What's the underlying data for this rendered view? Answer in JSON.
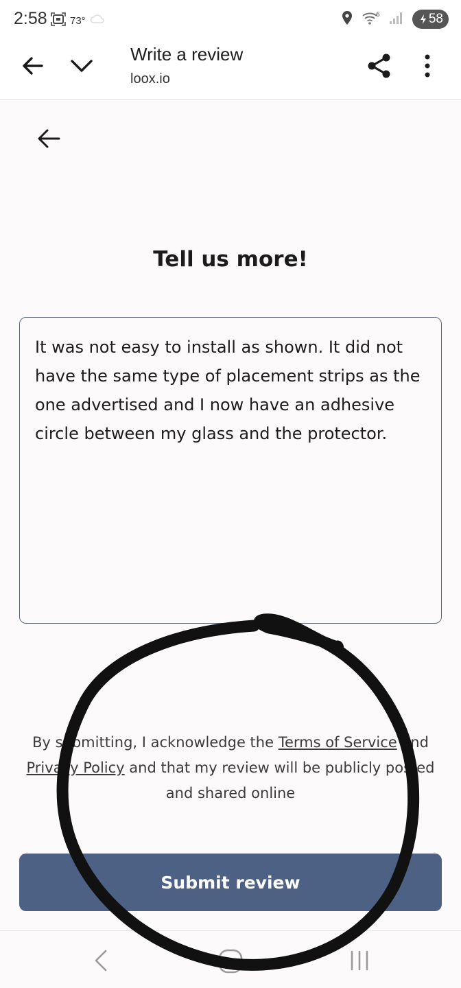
{
  "status_bar": {
    "time": "2:58",
    "temperature": "73°",
    "battery": "58",
    "icons": [
      "screenshot-icon",
      "weather-icon",
      "location-icon",
      "wifi-icon",
      "signal-icon",
      "battery-icon"
    ]
  },
  "browser": {
    "title": "Write a review",
    "url": "loox.io",
    "icons": [
      "back-arrow-icon",
      "chevron-down-icon",
      "share-icon",
      "more-vert-icon"
    ]
  },
  "page": {
    "heading": "Tell us more!",
    "review_text": "It was not easy to install as shown. It did not have the same type of placement strips as the one advertised and I now have an adhesive circle between my glass and the protector.",
    "consent": {
      "prefix": "By submitting, I acknowledge the ",
      "terms_link": "Terms of Service",
      "middle": " and ",
      "privacy_link": "Privacy Policy",
      "suffix": " and that my review will be publicly posted and shared online"
    },
    "submit_label": "Submit review"
  },
  "nav": {
    "icons": [
      "nav-back-icon",
      "nav-home-icon",
      "nav-recents-icon"
    ]
  },
  "colors": {
    "accent_button": "#4d6184",
    "background": "#fdfafb",
    "scribble": "#111111"
  }
}
